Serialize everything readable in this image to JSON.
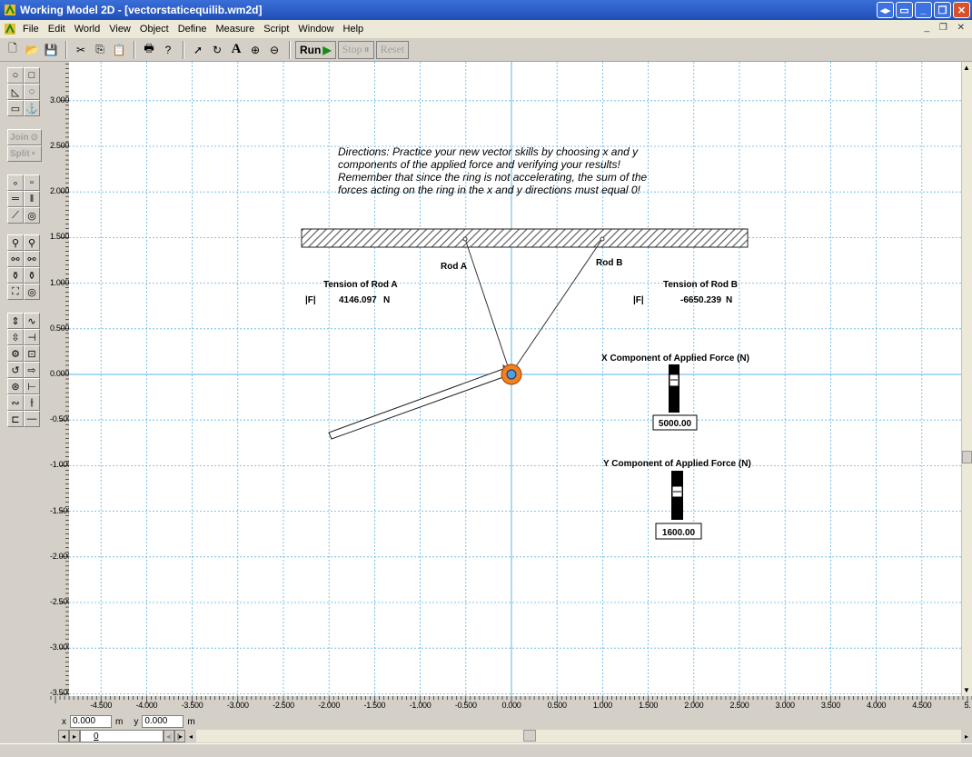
{
  "window": {
    "title": "Working Model 2D - [vectorstaticequilib.wm2d]"
  },
  "menu": [
    "File",
    "Edit",
    "World",
    "View",
    "Object",
    "Define",
    "Measure",
    "Script",
    "Window",
    "Help"
  ],
  "toolbar": {
    "run_label": "Run",
    "stop_label": "Stop",
    "reset_label": "Reset"
  },
  "toolbox": {
    "join_label": "Join",
    "split_label": "Split"
  },
  "axes": {
    "y_ticks": [
      "3.000",
      "2.500",
      "2.000",
      "1.500",
      "1.000",
      "0.500",
      "0.000",
      "-0.500",
      "-1.000",
      "-1.500",
      "-2.000",
      "-2.500",
      "-3.000",
      "-3.500"
    ],
    "x_ticks": [
      "-4.500",
      "-4.000",
      "-3.500",
      "-3.000",
      "-2.500",
      "-2.000",
      "-1.500",
      "-1.000",
      "-0.500",
      "0.000",
      "0.500",
      "1.000",
      "1.500",
      "2.000",
      "2.500",
      "3.000",
      "3.500",
      "4.000",
      "4.500",
      "5."
    ]
  },
  "scene": {
    "directions": [
      "Directions:  Practice your new vector skills by choosing x and y",
      "components of the applied force and verifying your results!",
      "Remember that since the ring is not accelerating, the sum of the",
      "forces acting on the ring in the x and y directions must equal 0!"
    ],
    "rod_a_label": "Rod A",
    "rod_b_label": "Rod B",
    "meter_a": {
      "title": "Tension of Rod A",
      "symbol": "|F|",
      "value": "4146.097",
      "unit": "N"
    },
    "meter_b": {
      "title": "Tension of Rod B",
      "symbol": "|F|",
      "value": "-6650.239",
      "unit": "N"
    },
    "slider_x": {
      "title": "X Component of Applied Force (N)",
      "value": "5000.00"
    },
    "slider_y": {
      "title": "Y Component of Applied Force (N)",
      "value": "1600.00"
    }
  },
  "coords": {
    "x_label": "x",
    "x_value": "0.000",
    "x_unit": "m",
    "y_label": "y",
    "y_value": "0.000",
    "y_unit": "m"
  },
  "frame_counter": "0",
  "colors": {
    "grid": "#5ab4e6",
    "ring": "#f08020",
    "titlebar": "#1f4fb5"
  }
}
